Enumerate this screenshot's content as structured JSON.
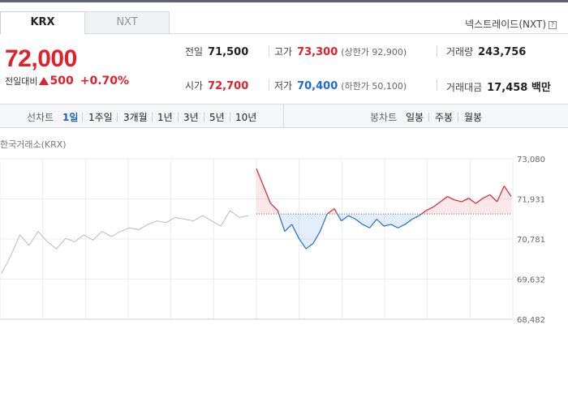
{
  "tabs": [
    {
      "label": "KRX",
      "active": true
    },
    {
      "label": "NXT",
      "active": false
    }
  ],
  "nxt_link": {
    "label": "넥스트레이드(NXT)",
    "help_icon": "question-icon",
    "help_glyph": "?"
  },
  "price": {
    "current": "72,000",
    "change_label": "전일대비",
    "change": "500",
    "change_pct": "+0.70%"
  },
  "stats": {
    "prev_close": {
      "label": "전일",
      "value": "71,500"
    },
    "high": {
      "label": "고가",
      "value": "73,300",
      "sub": "(상한가 92,900)"
    },
    "volume": {
      "label": "거래량",
      "value": "243,756"
    },
    "open": {
      "label": "시가",
      "value": "72,700"
    },
    "low": {
      "label": "저가",
      "value": "70,400",
      "sub": "(하한가 50,100)"
    },
    "amount": {
      "label": "거래대금",
      "value": "17,458 백만"
    }
  },
  "period_bar": {
    "line_label": "선차트",
    "line_periods": [
      {
        "label": "1일",
        "active": true
      },
      {
        "label": "1주일",
        "active": false
      },
      {
        "label": "3개월",
        "active": false
      },
      {
        "label": "1년",
        "active": false
      },
      {
        "label": "3년",
        "active": false
      },
      {
        "label": "5년",
        "active": false
      },
      {
        "label": "10년",
        "active": false
      }
    ],
    "candle_label": "봉차트",
    "candle_periods": [
      {
        "label": "일봉"
      },
      {
        "label": "주봉"
      },
      {
        "label": "월봉"
      }
    ]
  },
  "chart_title": "한국거래소(KRX)",
  "colors": {
    "up": "#e0202b",
    "down": "#1f6bd4",
    "prev_line": "#bbbbbb"
  },
  "chart_data": {
    "type": "line",
    "ylim": [
      68482,
      73080
    ],
    "y_ticks": [
      "73,080",
      "71,931",
      "70,781",
      "69,632",
      "68,482"
    ],
    "y_tick_values": [
      73080,
      71931,
      70781,
      69632,
      68482
    ],
    "baseline": 71500,
    "series": [
      {
        "values": [
          69800,
          70300,
          70900,
          70600,
          71000,
          70700,
          70500,
          70800,
          70700,
          70900,
          70750,
          71000,
          70850,
          71000,
          71100,
          71050,
          71200,
          71300,
          71250,
          71400,
          71350,
          71300,
          71450,
          71300,
          71150,
          71600,
          71400,
          71450
        ]
      },
      {
        "values": [
          72800,
          72300,
          71800,
          71600,
          71000,
          71200,
          70800,
          70500,
          70650,
          71000,
          71500,
          71650,
          71300,
          71450,
          71350,
          71200,
          71100,
          71350,
          71150,
          71200,
          71100,
          71200,
          71350,
          71450,
          71600,
          71700,
          71850,
          72000,
          71900,
          71850,
          71950,
          71800,
          71950,
          72050,
          71850,
          72300,
          72000
        ]
      }
    ]
  }
}
